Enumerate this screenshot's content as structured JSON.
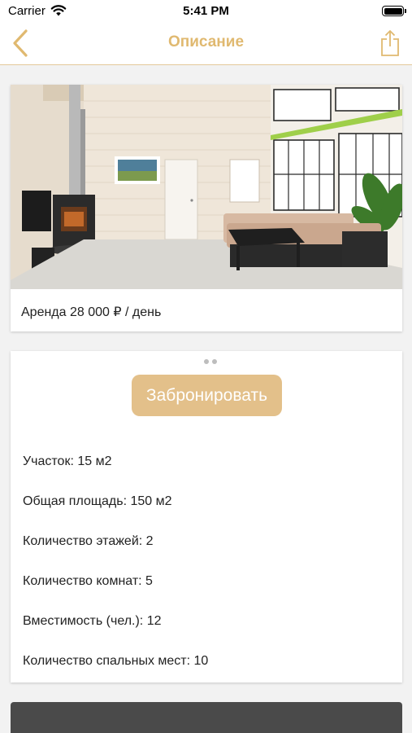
{
  "status_bar": {
    "carrier": "Carrier",
    "time": "5:41 PM"
  },
  "nav": {
    "title": "Описание",
    "accent_color": "#e0b970",
    "back_icon": "chevron-left-icon",
    "share_icon": "share-icon"
  },
  "listing": {
    "photo_count": 3,
    "active_photo_index": 0,
    "price": "Аренда 28 000 ₽ / день"
  },
  "booking": {
    "button_label": "Забронировать",
    "button_color": "#e3c08a"
  },
  "specs": [
    "Участок: 15 м2",
    "Общая площадь: 150 м2",
    "Количество этажей: 2",
    "Количество комнат: 5",
    "Вместимость (чел.): 12",
    "Количество спальных мест: 10"
  ]
}
